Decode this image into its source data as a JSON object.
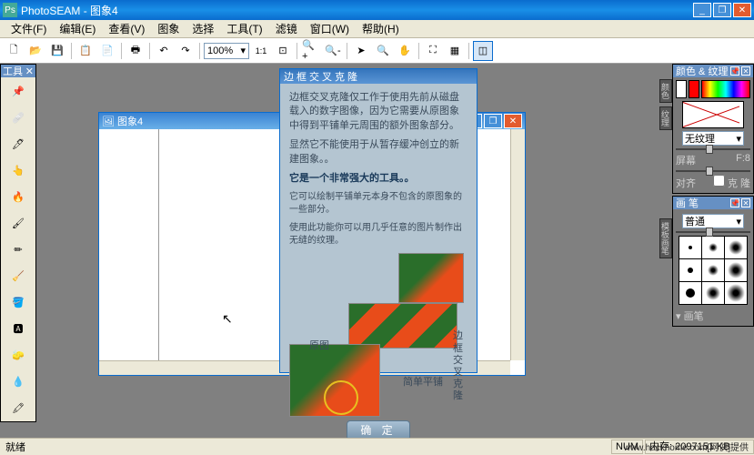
{
  "app": {
    "title": "PhotoSEAM - 图象4",
    "icon": "Ps"
  },
  "menu": [
    "文件(F)",
    "编辑(E)",
    "查看(V)",
    "图象",
    "选择",
    "工具(T)",
    "滤镜",
    "窗口(W)",
    "帮助(H)"
  ],
  "toolbar": {
    "zoom": "100%",
    "zoom_fit": "1:1"
  },
  "toolbox": {
    "title": "工具"
  },
  "canvas": {
    "title": "图象4"
  },
  "dialog": {
    "title": "边框交叉克隆",
    "p1": "边框交叉克隆仅工作于使用先前从磁盘载入的数字图像，因为它需要从原图象中得到平铺单元周围的额外图象部分。",
    "p2": "显然它不能使用于从暂存缓冲创立的新建图象。。",
    "p3": "它是一个非常强大的工具。。",
    "p4": "它可以绘制平铺单元本身不包含的原图象的一些部分。",
    "p5": "使用此功能你可以用几乎任意的图片制作出无缝的纹理。",
    "label_orig": "原图",
    "label_tile": "简单平铺",
    "label_clone": "边框\n交叉\n克隆",
    "ok": "确 定"
  },
  "panels": {
    "color": {
      "title": "颜色 & 纹理",
      "texture": "无纹理",
      "lbl_screen": "屏幕",
      "val_screen": "F:8",
      "lbl_opacity": "对齐",
      "chk_clone": "克 隆"
    },
    "brush": {
      "title": "画 笔",
      "mode": "普通",
      "section": "画笔"
    }
  },
  "status": {
    "left": "就绪",
    "num": "NUM",
    "mem": "内存: 2097151 KB"
  },
  "watermark": "www.hackhome.com[网侠]提供"
}
